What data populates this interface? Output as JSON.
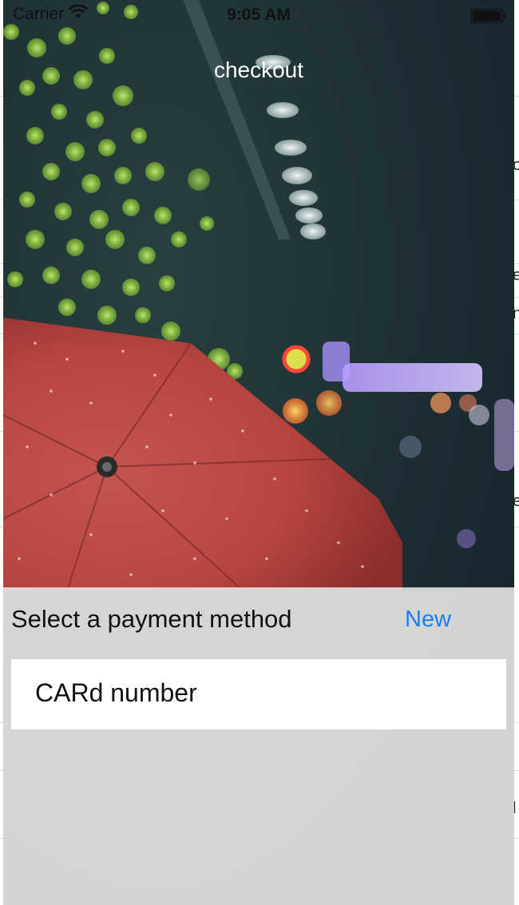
{
  "status_bar": {
    "carrier": "Carrier",
    "time": "9:05 AM",
    "wifi_icon": "wifi-icon",
    "battery_icon": "battery-icon"
  },
  "nav": {
    "title": "checkout"
  },
  "background_edge": [
    "o",
    "e",
    "n",
    "e",
    "l"
  ],
  "payment": {
    "title": "Select a payment method",
    "new_label": "New",
    "card_field_label": "CARd number"
  },
  "colors": {
    "accent": "#1a7ef5",
    "panel": "#ececec",
    "umbrella": "#c9524d",
    "photo_dark": "#1d3136"
  }
}
